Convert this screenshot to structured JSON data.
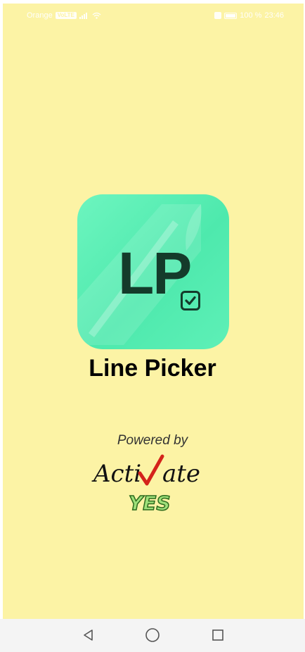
{
  "status_bar": {
    "carrier": "Orange",
    "volte_badge": "VoLTE",
    "battery_percent": "100 %",
    "time": "23:46"
  },
  "splash": {
    "app_icon": {
      "label": "LP",
      "checkbox_icon": "checkbox-checked-icon"
    },
    "app_title": "Line Picker",
    "powered_by": "Powered by",
    "brand_logo": {
      "text": "Activate",
      "subtext": "YES"
    }
  },
  "nav_bar": {
    "back_icon": "back-triangle-icon",
    "home_icon": "home-circle-icon",
    "recents_icon": "recents-square-icon"
  },
  "colors": {
    "background": "#fcf3a5",
    "icon_green": "#4ee9ad",
    "icon_text": "#143b2b",
    "logo_check_red": "#d4231b",
    "logo_yes_green": "#9ee07a"
  }
}
